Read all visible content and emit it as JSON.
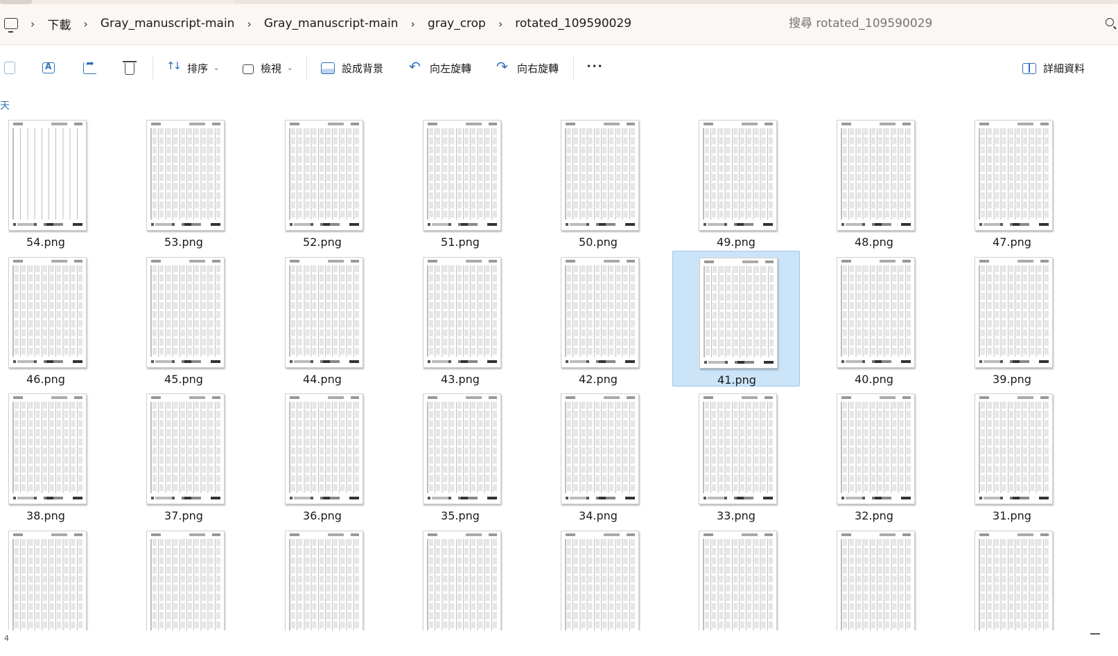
{
  "breadcrumb": {
    "items": [
      "下載",
      "Gray_manuscript-main",
      "Gray_manuscript-main",
      "gray_crop",
      "rotated_109590029"
    ]
  },
  "search": {
    "placeholder": "搜尋 rotated_109590029"
  },
  "toolbar": {
    "sort_label": "排序",
    "view_label": "檢視",
    "set_background_label": "設成背景",
    "rotate_left_label": "向左旋轉",
    "rotate_right_label": "向右旋轉",
    "details_label": "詳細資料"
  },
  "content": {
    "group_header": "天",
    "files": [
      {
        "name": "54.png",
        "blank": true
      },
      {
        "name": "53.png"
      },
      {
        "name": "52.png"
      },
      {
        "name": "51.png"
      },
      {
        "name": "50.png"
      },
      {
        "name": "49.png"
      },
      {
        "name": "48.png"
      },
      {
        "name": "47.png"
      },
      {
        "name": "46.png"
      },
      {
        "name": "45.png"
      },
      {
        "name": "44.png"
      },
      {
        "name": "43.png"
      },
      {
        "name": "42.png"
      },
      {
        "name": "41.png",
        "selected": true
      },
      {
        "name": "40.png"
      },
      {
        "name": "39.png"
      },
      {
        "name": "38.png"
      },
      {
        "name": "37.png"
      },
      {
        "name": "36.png"
      },
      {
        "name": "35.png"
      },
      {
        "name": "34.png"
      },
      {
        "name": "33.png"
      },
      {
        "name": "32.png"
      },
      {
        "name": "31.png"
      },
      {
        "name": ""
      },
      {
        "name": ""
      },
      {
        "name": ""
      },
      {
        "name": ""
      },
      {
        "name": ""
      },
      {
        "name": ""
      },
      {
        "name": ""
      },
      {
        "name": ""
      }
    ]
  },
  "status": {
    "item_count": "4"
  },
  "colors": {
    "selection": "#cce4f7",
    "accent": "#2e6fb8"
  }
}
